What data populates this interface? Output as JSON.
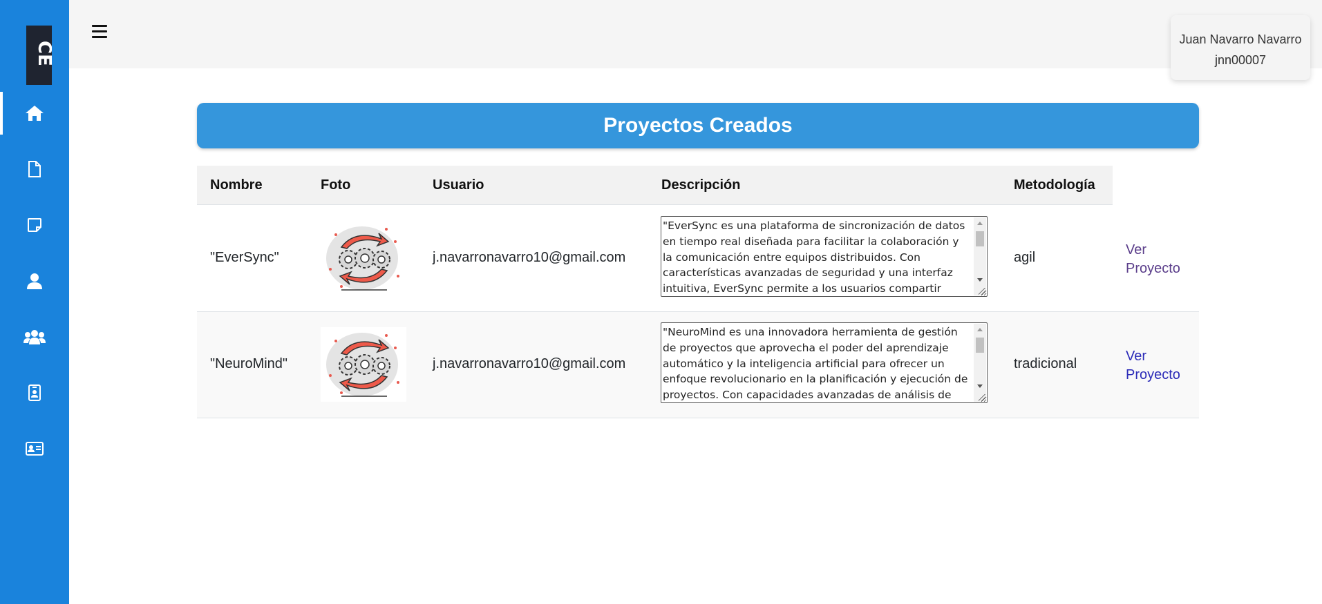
{
  "app": {
    "logo_text": "CE",
    "accent_color": "#1a83dc",
    "banner_color": "#3596dc"
  },
  "sidebar": {
    "items": [
      {
        "icon": "home-icon",
        "active": true
      },
      {
        "icon": "file-icon",
        "active": false
      },
      {
        "icon": "note-icon",
        "active": false
      },
      {
        "icon": "user-icon",
        "active": false
      },
      {
        "icon": "group-icon",
        "active": false
      },
      {
        "icon": "badge-icon",
        "active": false
      },
      {
        "icon": "id-card-icon",
        "active": false
      }
    ]
  },
  "header": {
    "menu_icon": "hamburger-icon",
    "user": {
      "name": "Juan Navarro Navarro",
      "username": "jnn00007"
    }
  },
  "main": {
    "title": "Proyectos Creados",
    "table": {
      "columns": [
        "Nombre",
        "Foto",
        "Usuario",
        "Descripción",
        "Metodología"
      ],
      "rows": [
        {
          "nombre": "\"EverSync\"",
          "foto_icon": "sync-gears-icon",
          "usuario": "j.navarronavarro10@gmail.com",
          "descripcion": "\"EverSync es una plataforma de sincronización de datos en tiempo real diseñada para facilitar la colaboración y la comunicación entre equipos distribuidos. Con características avanzadas de seguridad y una interfaz intuitiva, EverSync permite a los usuarios compartir",
          "metodologia": "agil",
          "action": "Ver Proyecto",
          "link_color": "#5a3d8a"
        },
        {
          "nombre": "\"NeuroMind\"",
          "foto_icon": "sync-gears-icon",
          "usuario": "j.navarronavarro10@gmail.com",
          "descripcion": "\"NeuroMind es una innovadora herramienta de gestión de proyectos que aprovecha el poder del aprendizaje automático y la inteligencia artificial para ofrecer un enfoque revolucionario en la planificación y ejecución de proyectos. Con capacidades avanzadas de análisis de",
          "metodologia": "tradicional",
          "action": "Ver Proyecto",
          "link_color": "#2b2bb8"
        }
      ]
    }
  }
}
